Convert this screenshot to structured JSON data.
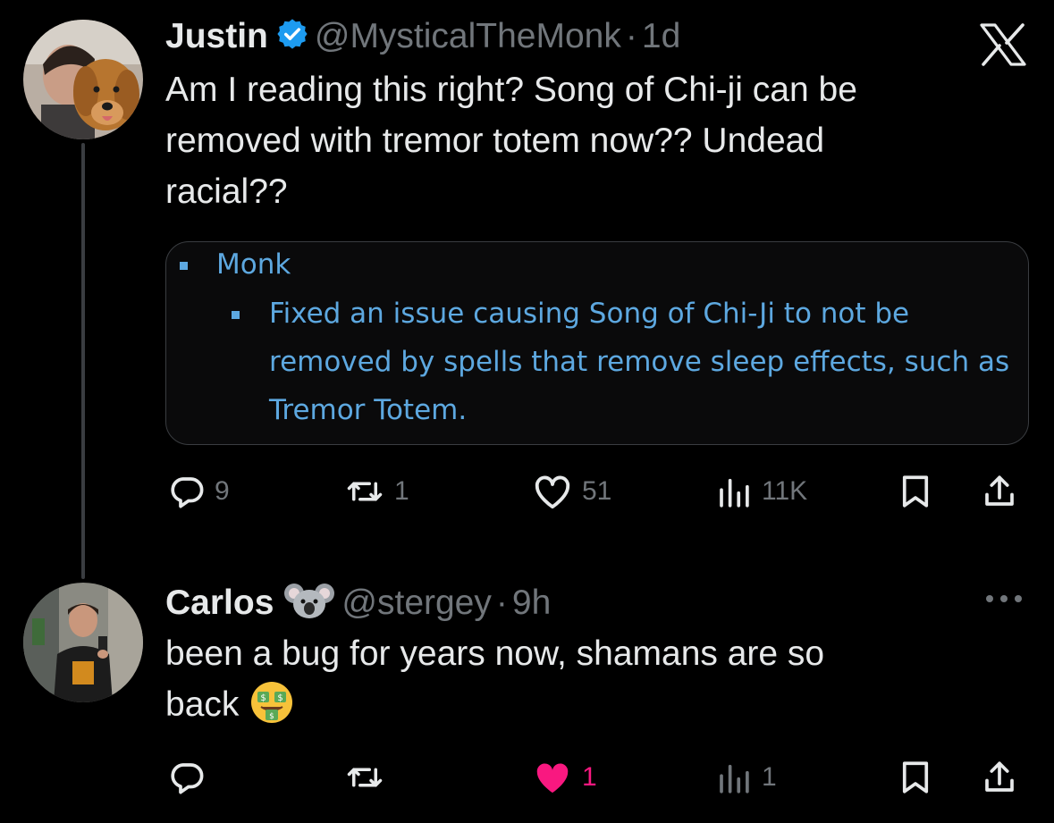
{
  "tweets": [
    {
      "name": "Justin",
      "handle": "@MysticalTheMonk",
      "separator": "·",
      "time": "1d",
      "text_lines": [
        "Am I reading this right? Song of Chi-ji can be",
        "removed with tremor totem now?? Undead",
        "racial??"
      ],
      "card": {
        "heading": "Monk",
        "body_lines": [
          "Fixed an issue causing Song of Chi-Ji to not be",
          "removed by spells that remove sleep effects, such as",
          "Tremor Totem."
        ]
      },
      "actions": {
        "replies": "9",
        "reposts": "1",
        "likes": "51",
        "views": "11K"
      }
    },
    {
      "name": "Carlos",
      "handle": "@stergey",
      "separator": "·",
      "time": "9h",
      "text_lines": [
        "been a bug for years now, shamans are so",
        "back"
      ],
      "actions": {
        "replies": "",
        "reposts": "",
        "likes": "1",
        "views": "1"
      }
    }
  ],
  "colors": {
    "background": "#000000",
    "text": "#e7e9ea",
    "muted": "#71767b",
    "verified": "#1d9bf0",
    "like_active": "#f91880",
    "card_text": "#5da8e0"
  }
}
